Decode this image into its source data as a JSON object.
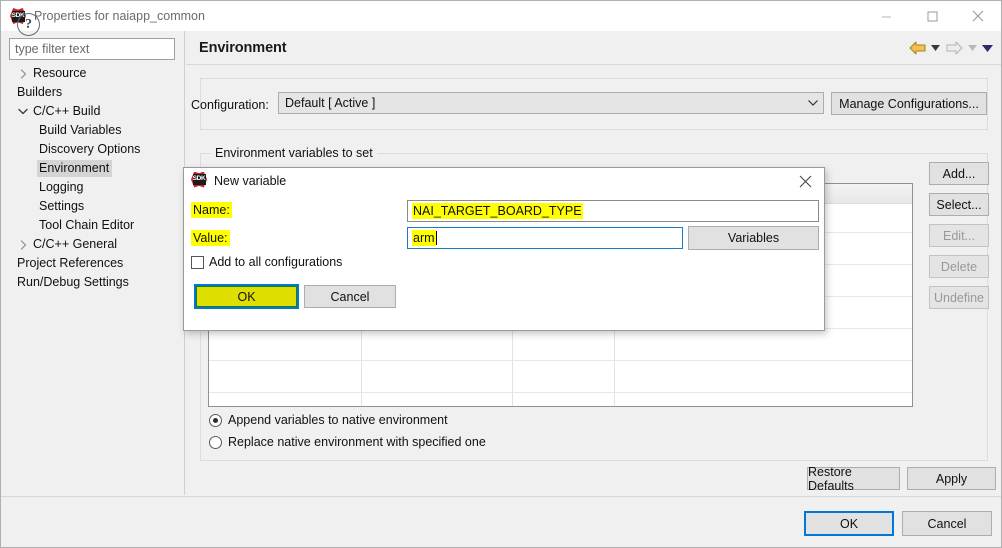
{
  "window": {
    "title": "Properties for naiapp_common",
    "icon": "sdk-icon",
    "controls": {
      "minimize": "minimize-icon",
      "maximize": "maximize-icon",
      "close": "close-icon"
    }
  },
  "sidebar": {
    "filter": {
      "placeholder": "type filter text",
      "value": ""
    },
    "items": [
      {
        "label": "Resource",
        "indent": 0,
        "arrow": "right",
        "selected": false
      },
      {
        "label": "Builders",
        "indent": 0,
        "arrow": "none",
        "selected": false
      },
      {
        "label": "C/C++ Build",
        "indent": 0,
        "arrow": "down",
        "selected": false
      },
      {
        "label": "Build Variables",
        "indent": 1,
        "arrow": "none",
        "selected": false
      },
      {
        "label": "Discovery Options",
        "indent": 1,
        "arrow": "none",
        "selected": false
      },
      {
        "label": "Environment",
        "indent": 1,
        "arrow": "none",
        "selected": true
      },
      {
        "label": "Logging",
        "indent": 1,
        "arrow": "none",
        "selected": false
      },
      {
        "label": "Settings",
        "indent": 1,
        "arrow": "none",
        "selected": false
      },
      {
        "label": "Tool Chain Editor",
        "indent": 1,
        "arrow": "none",
        "selected": false
      },
      {
        "label": "C/C++ General",
        "indent": 0,
        "arrow": "right",
        "selected": false
      },
      {
        "label": "Project References",
        "indent": 0,
        "arrow": "none",
        "selected": false
      },
      {
        "label": "Run/Debug Settings",
        "indent": 0,
        "arrow": "none",
        "selected": false
      }
    ]
  },
  "main": {
    "title": "Environment",
    "nav": {
      "back_icon": "back-arrow-icon",
      "back_caret_icon": "chevron-down-icon",
      "forward_icon": "forward-arrow-icon",
      "forward_caret_icon": "chevron-down-icon",
      "menu_caret_icon": "chevron-down-icon"
    },
    "configuration": {
      "label": "Configuration:",
      "value": "Default  [ Active ]",
      "manage_button": "Manage Configurations..."
    },
    "env_group_title": "Environment variables to set",
    "table": {
      "columns": [
        "",
        "",
        "",
        ""
      ],
      "rows": []
    },
    "side_buttons": [
      {
        "label": "Add...",
        "enabled": true
      },
      {
        "label": "Select...",
        "enabled": true
      },
      {
        "label": "Edit...",
        "enabled": false
      },
      {
        "label": "Delete",
        "enabled": false
      },
      {
        "label": "Undefine",
        "enabled": false
      }
    ],
    "radios": [
      {
        "label": "Append variables to native environment",
        "selected": true
      },
      {
        "label": "Replace native environment with specified one",
        "selected": false
      }
    ],
    "restore_defaults": "Restore Defaults",
    "apply": "Apply"
  },
  "footer": {
    "help_icon": "help-icon",
    "help_glyph": "?",
    "ok": "OK",
    "cancel": "Cancel"
  },
  "dialog": {
    "icon": "sdk-icon",
    "title": "New variable",
    "close_icon": "close-icon",
    "name_label": "Name:",
    "name_value": "NAI_TARGET_BOARD_TYPE",
    "value_label": "Value:",
    "value_value": "arm",
    "variables_button": "Variables",
    "add_all_label": "Add to all configurations",
    "add_all_checked": false,
    "ok": "OK",
    "cancel": "Cancel"
  },
  "colors": {
    "highlight_yellow": "#ffff00",
    "focus_blue": "#0078d7",
    "ok_green_border": "#1f7a1f",
    "back_arrow_gold": "#d9a520",
    "window_bg": "#f0f0f0"
  }
}
